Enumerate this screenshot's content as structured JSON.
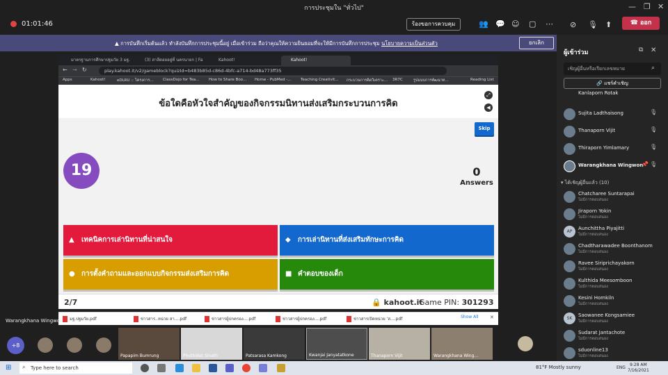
{
  "window": {
    "title": "การประชุมใน \"ทั่วไป\""
  },
  "meeting": {
    "elapsed": "01:01:46",
    "admit_label": "ร้องขอการควบคุม",
    "leave_label": "ออก"
  },
  "notice": {
    "text": "การบันทึกเริ่มต้นแล้ว ทำลังบันทึกการประชุมนี้อยู่ เมื่อเข้าร่วม ถือว่าคุณให้ความยินยอมที่จะให้มีการบันทึกการประชุม",
    "link": "นโยบายความเป็นส่วนตัว",
    "dismiss": "ยกเลิก"
  },
  "browser": {
    "tabs": [
      "มาตรฐานการศึกษาปฐมวัย 3 มฐ.",
      "(3) สาลีดอยอยู่ที่ นครนายก | Fa",
      "Kahoot!",
      "Kahoot!"
    ],
    "url": "play.kahoot.it/v2/gameblock?quizId=b483b85d-c86d-4bfc-a714-bd48a773ff35",
    "bookmarks": [
      "Apps",
      "Kahoot!",
      "eDLRU :: โครงการ...",
      "ClassDojo for Tea...",
      "How to Share Boo...",
      "Home - PubMed -...",
      "Teaching Creativit...",
      "กระบวนการคิดวิเคราะ...",
      "3R7C",
      "รูปแบบการพัฒนาท...",
      "Reading List"
    ]
  },
  "kahoot": {
    "question": "ข้อใดคือหัวใจสำคัญของกิจกรรมนิทานส่งเสริมกระบวนการคิด",
    "skip": "Skip",
    "timer": "19",
    "answers_count": "0",
    "answers_label": "Answers",
    "options": [
      {
        "shape": "▲",
        "text": "เทคนิคการเล่านิทานที่น่าสนใจ",
        "color": "#e21b3c"
      },
      {
        "shape": "◆",
        "text": "การเล่านิทานที่ส่งเสริมทักษะการคิด",
        "color": "#1368ce"
      },
      {
        "shape": "●",
        "text": "การตั้งคำถามและออกแบบกิจกรรมส่งเสริมการคิด",
        "color": "#d89e00"
      },
      {
        "shape": "■",
        "text": "คำตอบของเด็ก",
        "color": "#26890c"
      }
    ],
    "progress": "2/7",
    "brand": "kahoot.it",
    "pin_label": "Game PIN:",
    "pin": "301293"
  },
  "downloads": {
    "files": [
      "มฐ.ปฐมวัย.pdf",
      "ข่าวสาร..หน่วย สา....pdf",
      "ข่าวสารผู้ปกครอง....pdf",
      "ข่าวสารผู้ปกครอง....pdf",
      "ข่าวสารเปิดหน่วย 'ส....pdf"
    ],
    "show_all": "Show All"
  },
  "presenter": "Warangkhana Wingwon",
  "videos": {
    "more": "+8",
    "tiles": [
      "Papapim Bumrung",
      "Phuthidet Sinath",
      "Patsarasa Kamkong",
      "Kwanjai Janyatatkone",
      "Thanaporn Vijit",
      "Warangkhana Wing..."
    ]
  },
  "panel": {
    "title": "ผู้เข้าร่วม",
    "search_placeholder": "เชิญผู้อื่นหรือเรียกเลขหมาย",
    "share": "แชร์คำเชิญ",
    "top_partial": "Kanlaporn Rotak",
    "in_meeting": [
      "Sujita Ladthaisong",
      "Thanaporn Vijit",
      "Thiraporn Yimlamary",
      "Warangkhana Wingwon"
    ],
    "invited_header": "ได้เชิญผู้อื่นแล้ว (10)",
    "invited": [
      {
        "name": "Chatcharee Suntarapai",
        "initials": "",
        "status": "ไม่มีการตอบสนอง"
      },
      {
        "name": "Jiraporn Yokin",
        "initials": "",
        "status": "ไม่มีการตอบสนอง"
      },
      {
        "name": "Aunchittha Piyajitti",
        "initials": "AP",
        "status": "ไม่มีการตอบสนอง"
      },
      {
        "name": "Chadtharawadee Boonthanom",
        "initials": "",
        "status": "ไม่มีการตอบสนอง"
      },
      {
        "name": "Ravee Siriprichayakorn",
        "initials": "",
        "status": "ไม่มีการตอบสนอง"
      },
      {
        "name": "Kulthida Meesomboon",
        "initials": "",
        "status": "ไม่มีการตอบสนอง"
      },
      {
        "name": "Kesini Homkiln",
        "initials": "",
        "status": "ไม่มีการตอบสนอง"
      },
      {
        "name": "Saowanee Kongsamiee",
        "initials": "SK",
        "status": "ไม่มีการตอบสนอง"
      },
      {
        "name": "Sudarat Jantachote",
        "initials": "",
        "status": "ไม่มีการตอบสนอง"
      },
      {
        "name": "sduonline13",
        "initials": "",
        "status": "ไม่มีการตอบสนอง"
      }
    ]
  },
  "taskbar": {
    "search": "Type here to search",
    "weather": "81°F  Mostly sunny",
    "lang": "ENG",
    "time": "9:28 AM",
    "date": "7/16/2021"
  }
}
